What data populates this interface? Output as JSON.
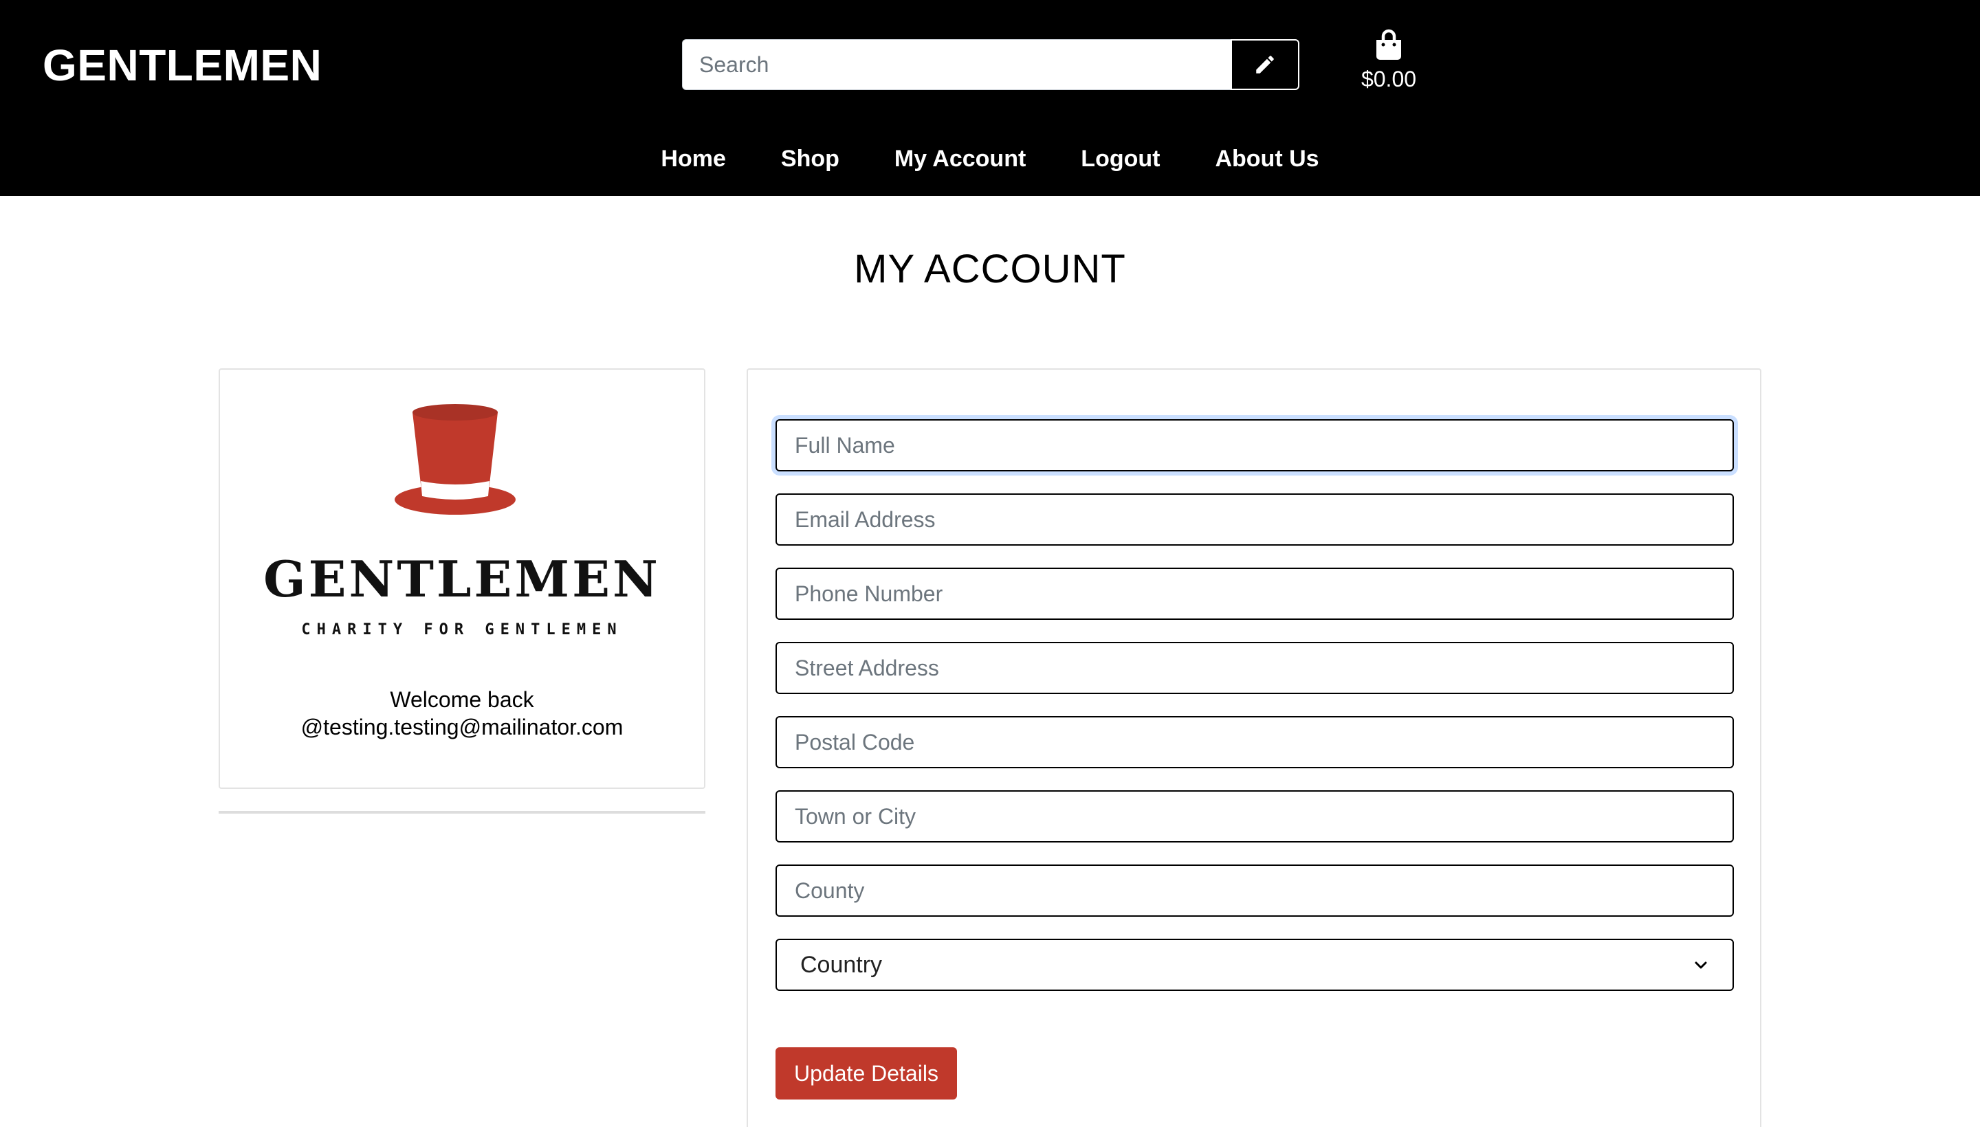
{
  "header": {
    "brand": "GENTLEMEN",
    "search": {
      "placeholder": "Search",
      "button_icon": "pencil-icon"
    },
    "cart": {
      "icon": "shopping-bag-icon",
      "total": "$0.00"
    },
    "nav": [
      {
        "label": "Home"
      },
      {
        "label": "Shop"
      },
      {
        "label": "My Account"
      },
      {
        "label": "Logout"
      },
      {
        "label": "About Us"
      }
    ]
  },
  "main": {
    "title": "MY ACCOUNT",
    "profile": {
      "logo_icon": "top-hat-icon",
      "logo_wordmark": "GENTLEMEN",
      "logo_tagline": "CHARITY FOR GENTLEMEN",
      "welcome_line1": "Welcome back",
      "welcome_line2": "@testing.testing@mailinator.com"
    },
    "form": {
      "fields": {
        "full_name": {
          "placeholder": "Full Name",
          "value": ""
        },
        "email": {
          "placeholder": "Email Address",
          "value": ""
        },
        "phone": {
          "placeholder": "Phone Number",
          "value": ""
        },
        "street": {
          "placeholder": "Street Address",
          "value": ""
        },
        "postal": {
          "placeholder": "Postal Code",
          "value": ""
        },
        "town": {
          "placeholder": "Town or City",
          "value": ""
        },
        "county": {
          "placeholder": "County",
          "value": ""
        }
      },
      "country_select": {
        "selected": "Country"
      },
      "submit_label": "Update Details"
    }
  },
  "colors": {
    "header_bg": "#000000",
    "accent_red": "#c0392b",
    "hat_red": "#c0392b"
  }
}
